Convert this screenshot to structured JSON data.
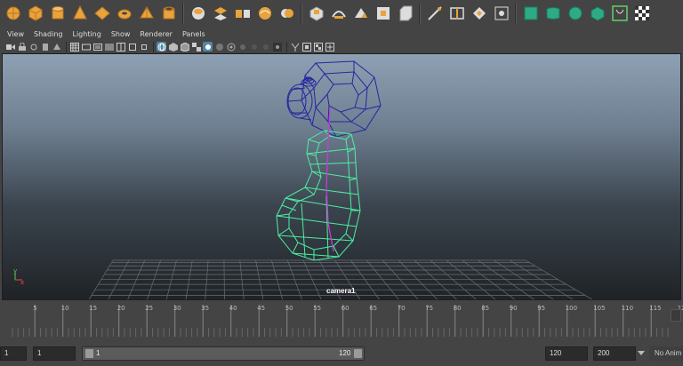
{
  "shelf": {
    "icons": [
      "poly-sphere-icon",
      "poly-cube-icon",
      "poly-cylinder-icon",
      "poly-cone-icon",
      "poly-plane-icon",
      "poly-torus-icon",
      "poly-pyramid-icon",
      "poly-pipe-icon",
      "separator",
      "combine-icon",
      "separate-icon",
      "extract-icon",
      "smooth-icon",
      "booleans-icon",
      "separator",
      "extrude-icon",
      "bridge-icon",
      "append-polygon-icon",
      "fill-hole-icon",
      "bevel-icon",
      "separator",
      "multi-cut-icon",
      "insert-edge-loop-icon",
      "offset-edge-loop-icon",
      "merge-icon",
      "separator",
      "uv-planar-icon",
      "uv-cylindrical-icon",
      "uv-spherical-icon",
      "uv-automatic-icon",
      "uv-cut-icon",
      "uv-checker-icon"
    ]
  },
  "panel_menu": {
    "items": [
      "View",
      "Shading",
      "Lighting",
      "Show",
      "Renderer",
      "Panels"
    ]
  },
  "viewport": {
    "camera_label": "camera1",
    "axis_y_label": "y",
    "axis_x_label": "x",
    "colors": {
      "selected_mesh": "#55e0a0",
      "other_mesh": "#2a2a9a",
      "skeleton": "#c040d0",
      "grid": "#707070"
    }
  },
  "timeline": {
    "ticks": [
      "5",
      "10",
      "15",
      "20",
      "25",
      "30",
      "35",
      "40",
      "45",
      "50",
      "55",
      "60",
      "65",
      "70",
      "75",
      "80",
      "85",
      "90",
      "95",
      "100",
      "105",
      "110",
      "115",
      "12"
    ]
  },
  "range": {
    "anim_start": "1",
    "playback_start": "1",
    "range_start_label": "1",
    "range_end_label": "120",
    "playback_end": "120",
    "anim_end": "200",
    "anim_layer": "No Anim Layer"
  }
}
